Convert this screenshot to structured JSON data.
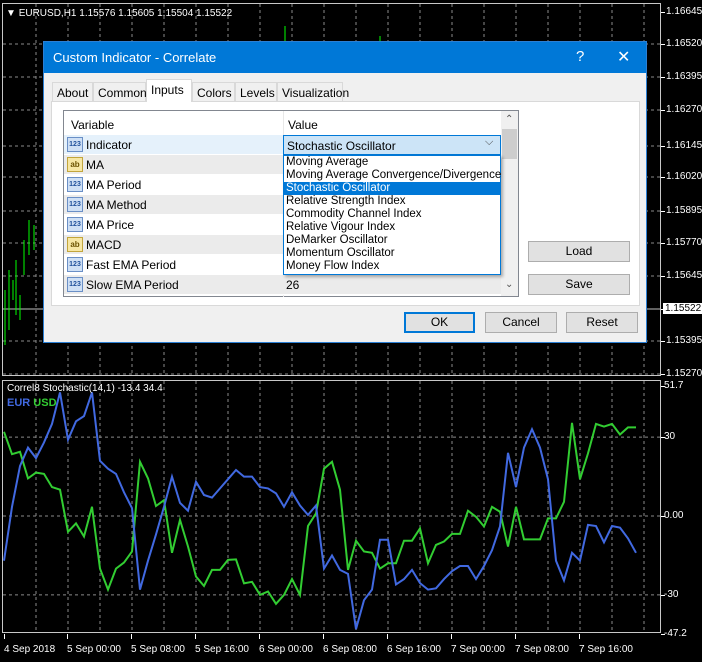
{
  "chart": {
    "symbol_header": "EURUSD,H1  1.15576 1.15605 1.15504 1.15522",
    "price_labels": [
      "1.16645",
      "1.16520",
      "1.16395",
      "1.16270",
      "1.16145",
      "1.16020",
      "1.15895",
      "1.15770",
      "1.15645",
      "1.15522",
      "1.15395",
      "1.15270"
    ],
    "current_price": "1.15522",
    "candle_color": "#00ff00"
  },
  "indicator_panel": {
    "header": "Correl8 Stochastic(14,1) -13.4 34.4",
    "legend_eur": "EUR",
    "legend_usd": "USD",
    "scale_labels": [
      "51.7",
      "30",
      "0.00",
      "-30",
      "-47.2"
    ],
    "time_labels": [
      "4 Sep 2018",
      "5 Sep 00:00",
      "5 Sep 08:00",
      "5 Sep 16:00",
      "6 Sep 00:00",
      "6 Sep 08:00",
      "6 Sep 16:00",
      "7 Sep 00:00",
      "7 Sep 08:00",
      "7 Sep 16:00"
    ],
    "colors": {
      "eur": "#4169e1",
      "usd": "#32cd32"
    },
    "ylim": [
      -47.2,
      51.7
    ],
    "eur_values": [
      -17,
      3.5,
      19,
      26,
      22,
      28,
      35,
      47,
      29,
      36,
      38,
      47,
      21,
      18,
      16,
      9,
      3,
      -28,
      -17,
      -7,
      3.5,
      15,
      5,
      2,
      13,
      8,
      7,
      10.5,
      14,
      17.5,
      15,
      15,
      11,
      10.5,
      8.6,
      3.5,
      9,
      4,
      0.4,
      4,
      -20,
      -15,
      -20.5,
      -22,
      -43,
      -32,
      -28,
      -9,
      -9,
      -26,
      -24,
      -20.5,
      -25.5,
      -28,
      -27.5,
      -24,
      -21,
      -19,
      -19,
      -24,
      -19,
      -13,
      -4,
      24,
      11,
      26,
      33,
      26,
      14,
      -17,
      -24.5,
      -14,
      -17,
      -3.4,
      -3.8,
      -10,
      -3.8,
      -4.4,
      -8.5,
      -14
    ],
    "usd_values": [
      32,
      23.5,
      24.4,
      14.3,
      16.5,
      16,
      11,
      10,
      -6,
      -2.8,
      -7.8,
      3.5,
      -20,
      -28,
      -20,
      -17.7,
      -13.5,
      20.6,
      14.3,
      3.8,
      6,
      -14,
      -1.5,
      -11.6,
      -23,
      -26.6,
      -20.5,
      -20.5,
      -16.7,
      -16.5,
      -25.6,
      -25,
      -30,
      -28.7,
      -33.4,
      -30,
      -24,
      -30,
      -3.8,
      1,
      18,
      20.6,
      10,
      -20.5,
      -9.4,
      -13.5,
      -14,
      -20,
      -18,
      -18,
      -9.4,
      -9.4,
      -4.7,
      -18,
      -11,
      -9.7,
      -6.8,
      -6.8,
      2,
      -0.3,
      -4,
      3.5,
      1.6,
      -11.6,
      3.5,
      -8.9,
      -8.9,
      -8.9,
      -0.9,
      -0.9,
      5.4,
      35.4,
      14,
      23.8,
      35,
      34,
      35,
      31,
      33.7,
      33.7
    ]
  },
  "dialog": {
    "title": "Custom Indicator - Correlate",
    "help_label": "?",
    "close_label": "✕",
    "tabs": [
      "About",
      "Common",
      "Inputs",
      "Colors",
      "Levels",
      "Visualization"
    ],
    "active_tab": "Inputs",
    "columns": {
      "variable": "Variable",
      "value": "Value"
    },
    "rows": [
      {
        "type": "123",
        "variable": "Indicator",
        "value": "Stochastic Oscillator"
      },
      {
        "type": "ab",
        "variable": "MA",
        "value": ""
      },
      {
        "type": "123",
        "variable": "MA Period",
        "value": ""
      },
      {
        "type": "123",
        "variable": "MA Method",
        "value": ""
      },
      {
        "type": "123",
        "variable": "MA Price",
        "value": ""
      },
      {
        "type": "ab",
        "variable": "MACD",
        "value": ""
      },
      {
        "type": "123",
        "variable": "Fast EMA Period",
        "value": ""
      },
      {
        "type": "123",
        "variable": "Slow EMA Period",
        "value": "26"
      }
    ],
    "dropdown_options": [
      "Moving Average",
      "Moving Average Convergence/Divergence",
      "Stochastic Oscillator",
      "Relative Strength Index",
      "Commodity Channel Index",
      "Relative Vigour Index",
      "DeMarker Oscillator",
      "Momentum Oscillator",
      "Money Flow Index"
    ],
    "dropdown_selected": "Stochastic Oscillator",
    "buttons": {
      "load": "Load",
      "save": "Save",
      "ok": "OK",
      "cancel": "Cancel",
      "reset": "Reset"
    }
  }
}
